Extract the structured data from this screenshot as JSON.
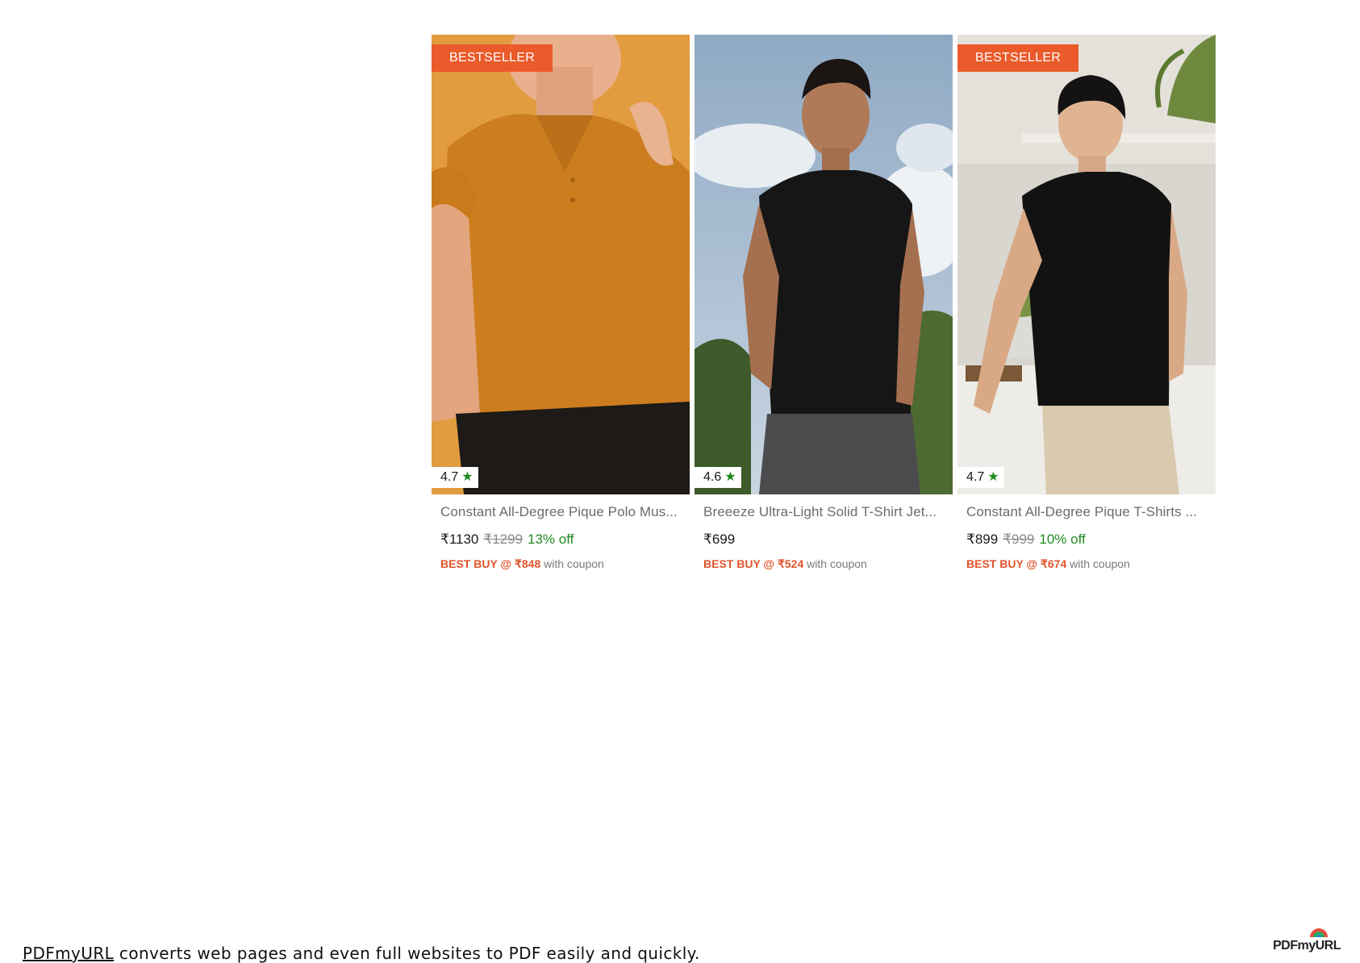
{
  "products": [
    {
      "badge": "BESTSELLER",
      "rating": "4.7",
      "title": "Constant All-Degree Pique Polo Mus...",
      "price": "₹1130",
      "mrp": "₹1299",
      "discount": "13% off",
      "best_buy": "BEST BUY @ ₹848",
      "coupon_suffix": "with coupon"
    },
    {
      "badge": "",
      "rating": "4.6",
      "title": "Breeeze Ultra-Light Solid T-Shirt Jet...",
      "price": "₹699",
      "mrp": "",
      "discount": "",
      "best_buy": "BEST BUY @ ₹524",
      "coupon_suffix": "with coupon"
    },
    {
      "badge": "BESTSELLER",
      "rating": "4.7",
      "title": "Constant All-Degree Pique T-Shirts ...",
      "price": "₹899",
      "mrp": "₹999",
      "discount": "10% off",
      "best_buy": "BEST BUY @ ₹674",
      "coupon_suffix": "with coupon"
    }
  ],
  "footer": {
    "link": "PDFmyURL",
    "text": " converts web pages and even full websites to PDF easily and quickly."
  },
  "logo": "PDFmyURL",
  "icons": {
    "star": "star-icon"
  },
  "colors": {
    "badge": "#ea5a2a",
    "discount": "#1e8a1e",
    "best_buy": "#e0542a"
  }
}
